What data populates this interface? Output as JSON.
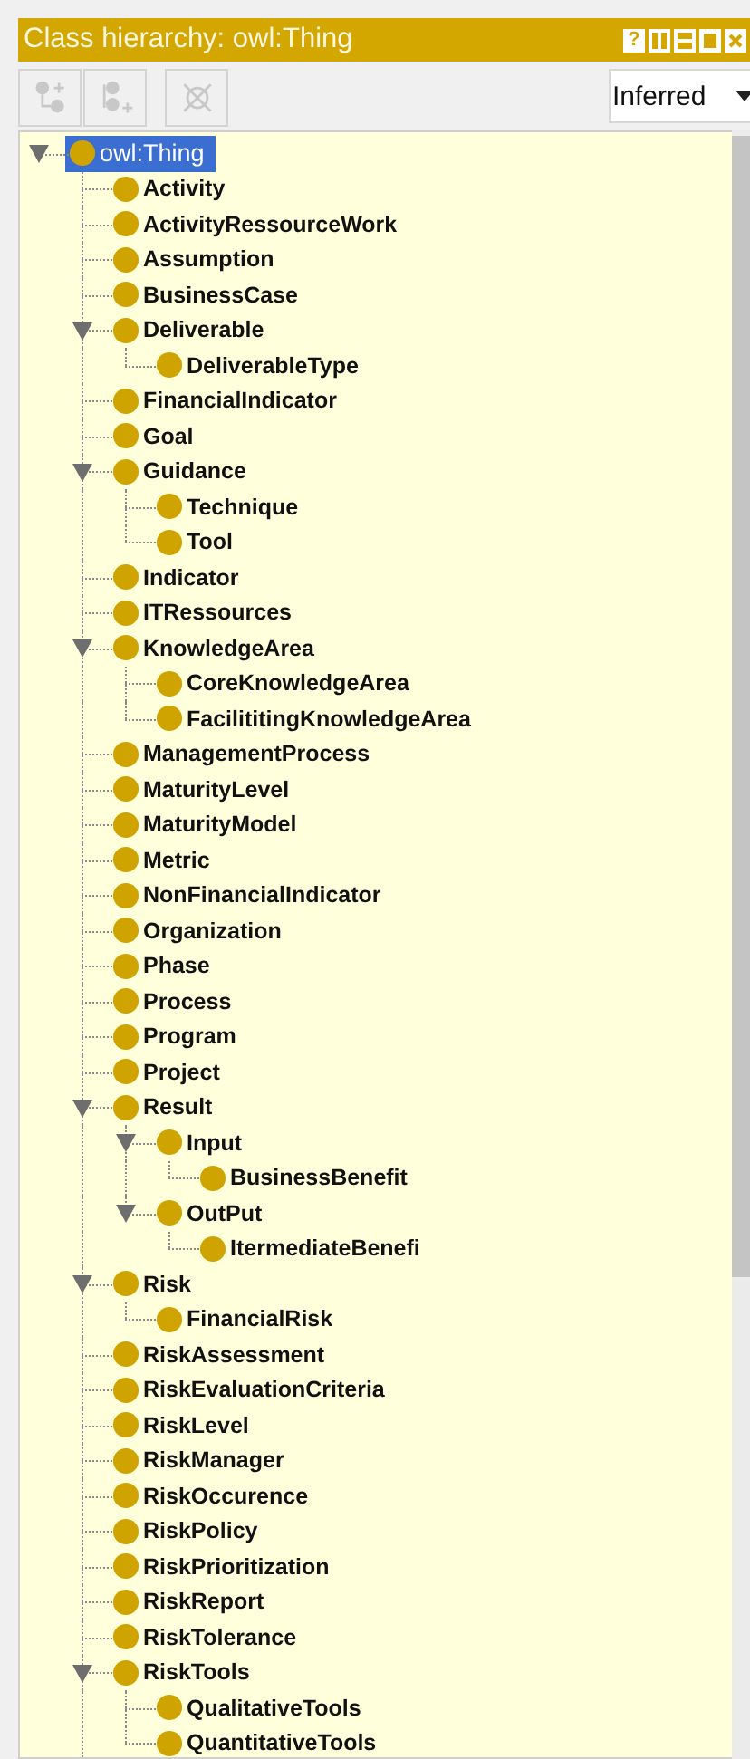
{
  "panel": {
    "title": "Class hierarchy: owl:Thing",
    "help_button": "?"
  },
  "toolbar": {
    "buttons": [
      {
        "kind": "add-subclass",
        "disabled": true
      },
      {
        "kind": "add-sibling",
        "disabled": true
      },
      {
        "kind": "delete",
        "disabled": true
      }
    ],
    "view_select": "Inferred"
  },
  "class_tree": {
    "label": "owl:Thing",
    "selected": true,
    "expanded": true,
    "children": [
      {
        "label": "Activity",
        "selected": false
      },
      {
        "label": "ActivityRessourceWork",
        "selected": false
      },
      {
        "label": "Assumption",
        "selected": false
      },
      {
        "label": "BusinessCase",
        "selected": false
      },
      {
        "label": "Deliverable",
        "selected": false,
        "expanded": true,
        "children": [
          {
            "label": "DeliverableType",
            "selected": false
          }
        ]
      },
      {
        "label": "FinancialIndicator",
        "selected": false
      },
      {
        "label": "Goal",
        "selected": false
      },
      {
        "label": "Guidance",
        "selected": false,
        "expanded": true,
        "children": [
          {
            "label": "Technique",
            "selected": false
          },
          {
            "label": "Tool",
            "selected": false
          }
        ]
      },
      {
        "label": "Indicator",
        "selected": false
      },
      {
        "label": "ITRessources",
        "selected": false
      },
      {
        "label": "KnowledgeArea",
        "selected": false,
        "expanded": true,
        "children": [
          {
            "label": "CoreKnowledgeArea",
            "selected": false
          },
          {
            "label": "FacilititingKnowledgeArea",
            "selected": false
          }
        ]
      },
      {
        "label": "ManagementProcess",
        "selected": false
      },
      {
        "label": "MaturityLevel",
        "selected": false
      },
      {
        "label": "MaturityModel",
        "selected": false
      },
      {
        "label": "Metric",
        "selected": false
      },
      {
        "label": "NonFinancialIndicator",
        "selected": false
      },
      {
        "label": "Organization",
        "selected": false
      },
      {
        "label": "Phase",
        "selected": false
      },
      {
        "label": "Process",
        "selected": false
      },
      {
        "label": "Program",
        "selected": false
      },
      {
        "label": "Project",
        "selected": false
      },
      {
        "label": "Result",
        "selected": false,
        "expanded": true,
        "children": [
          {
            "label": "Input",
            "selected": false,
            "expanded": true,
            "children": [
              {
                "label": "BusinessBenefit",
                "selected": false
              }
            ]
          },
          {
            "label": "OutPut",
            "selected": false,
            "expanded": true,
            "children": [
              {
                "label": "ItermediateBenefi",
                "selected": false
              }
            ]
          }
        ]
      },
      {
        "label": "Risk",
        "selected": false,
        "expanded": true,
        "children": [
          {
            "label": "FinancialRisk",
            "selected": false
          }
        ]
      },
      {
        "label": "RiskAssessment",
        "selected": false
      },
      {
        "label": "RiskEvaluationCriteria",
        "selected": false
      },
      {
        "label": "RiskLevel",
        "selected": false
      },
      {
        "label": "RiskManager",
        "selected": false
      },
      {
        "label": "RiskOccurence",
        "selected": false
      },
      {
        "label": "RiskPolicy",
        "selected": false
      },
      {
        "label": "RiskPrioritization",
        "selected": false
      },
      {
        "label": "RiskReport",
        "selected": false
      },
      {
        "label": "RiskTolerance",
        "selected": false
      },
      {
        "label": "RiskTools",
        "selected": false,
        "expanded": true,
        "children": [
          {
            "label": "QualitativeTools",
            "selected": false
          },
          {
            "label": "QuantitativeTools",
            "selected": false
          }
        ]
      }
    ]
  }
}
